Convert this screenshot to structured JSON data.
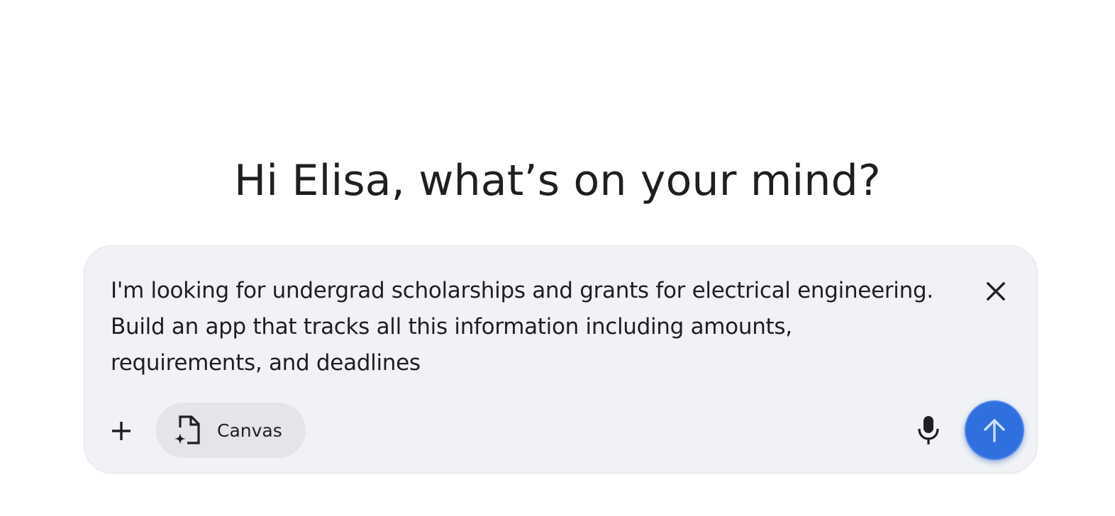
{
  "greeting": "Hi Elisa, what’s on your mind?",
  "composer": {
    "prompt_text": "I'm looking for undergrad scholarships and grants for electrical engineering.\nBuild an app that tracks all this information including amounts,\nrequirements, and deadlines",
    "clear_icon": "close-icon",
    "toolbar": {
      "add_icon": "plus-icon",
      "canvas_chip": {
        "label": "Canvas",
        "icon": "canvas-document-sparkle-icon"
      },
      "mic_icon": "microphone-icon",
      "send_icon": "arrow-up-icon"
    }
  },
  "colors": {
    "composer_bg": "#f0f2f6",
    "chip_bg": "#e3e5e9",
    "send_button": "#2f6fde",
    "text": "#1f1f1f"
  }
}
